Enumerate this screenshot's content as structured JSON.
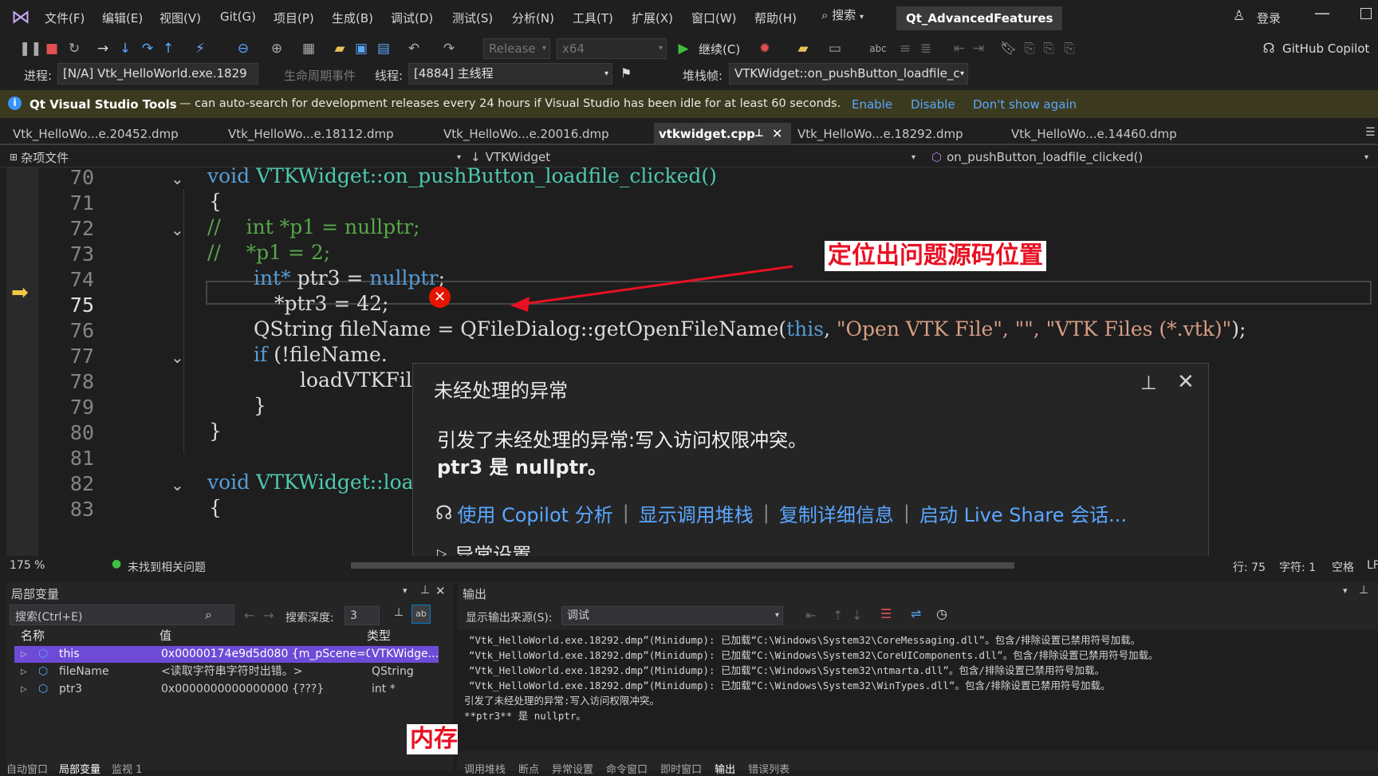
{
  "menu": {
    "items": [
      "文件(F)",
      "编辑(E)",
      "视图(V)",
      "Git(G)",
      "项目(P)",
      "生成(B)",
      "调试(D)",
      "测试(S)",
      "分析(N)",
      "工具(T)",
      "扩展(X)",
      "窗口(W)",
      "帮助(H)"
    ],
    "search": "搜索",
    "solution": "Qt_AdvancedFeatures",
    "login": "登录",
    "copilot": "GitHub Copilot"
  },
  "toolbar": {
    "config": "Release",
    "platform": "x64",
    "continue": "继续(C)"
  },
  "debugbar": {
    "process_label": "进程:",
    "process_value": "[N/A] Vtk_HelloWorld.exe.1829",
    "lifecycle": "生命周期事件",
    "thread_label": "线程:",
    "thread_value": "[4884] 主线程",
    "stack_label": "堆栈帧:",
    "stack_value": "VTKWidget::on_pushButton_loadfile_c"
  },
  "infobar": {
    "title": "Qt Visual Studio Tools",
    "message": "— can auto-search for development releases every 24 hours if Visual Studio has been idle for at least 60 seconds.",
    "enable": "Enable",
    "disable": "Disable",
    "dont_show": "Don't show again"
  },
  "tabs": [
    {
      "label": "Vtk_HelloWo...e.20452.dmp"
    },
    {
      "label": "Vtk_HelloWo...e.18112.dmp"
    },
    {
      "label": "Vtk_HelloWo...e.20016.dmp"
    },
    {
      "label": "vtkwidget.cpp"
    },
    {
      "label": "Vtk_HelloWo...e.18292.dmp"
    },
    {
      "label": "Vtk_HelloWo...e.14460.dmp"
    }
  ],
  "navbar": {
    "scope": "杂项文件",
    "class": "VTKWidget",
    "method": "on_pushButton_loadfile_clicked()"
  },
  "code": {
    "line_numbers": [
      "70",
      "71",
      "72",
      "73",
      "74",
      "75",
      "76",
      "77",
      "78",
      "79",
      "80",
      "81",
      "82",
      "83"
    ],
    "l70_kw": "void",
    "l70_rest": "VTKWidget::on_pushButton_loadfile_clicked()",
    "l71": "{",
    "l72": "//    int *p1 = nullptr;",
    "l73": "//    *p1 = 2;",
    "l74_kw": "int*",
    "l74_rest": " ptr3 = ",
    "l74_null": "nullptr",
    "l74_end": ";",
    "l75": "*ptr3 = 42;",
    "l76_a": "QString fileName = QFileDialog::getOpenFileName(",
    "l76_this": "this",
    "l76_b": ", ",
    "l76_str": "\"Open VTK File\", \"\", \"VTK Files (*.vtk)\"",
    "l76_end": ");",
    "l77_kw": "if",
    "l77_rest": " (!fileName.",
    "l78": "loadVTKFil",
    "l79": "}",
    "l80": "}",
    "l82_kw": "void",
    "l82_rest": "VTKWidget::loa",
    "l83": "{"
  },
  "popup": {
    "title": "未经处理的异常",
    "message1": "引发了未经处理的异常:写入访问权限冲突。",
    "message2": "ptr3 是 nullptr。",
    "copilot": "使用 Copilot 分析",
    "callstack": "显示调用堆栈",
    "copy": "复制详细信息",
    "liveshare": "启动 Live Share 会话...",
    "settings": "异常设置"
  },
  "annotations": {
    "source": "定位出问题源码位置",
    "memory": "内存变量值"
  },
  "status": {
    "zoom": "175 %",
    "issues": "未找到相关问题",
    "line": "行: 75",
    "char": "字符: 1",
    "space": "空格",
    "eol": "LF"
  },
  "locals": {
    "title": "局部变量",
    "search_placeholder": "搜索(Ctrl+E)",
    "depth_label": "搜索深度:",
    "depth": "3",
    "col_name": "名称",
    "col_value": "值",
    "col_type": "类型",
    "rows": [
      {
        "name": "this",
        "value": "0x00000174e9d5d080 {m_pScene=0x...",
        "type": "VTKWidge..."
      },
      {
        "name": "fileName",
        "value": "<读取字符串字符时出错。>",
        "type": "QString"
      },
      {
        "name": "ptr3",
        "value": "0x0000000000000000 {???}",
        "type": "int *"
      }
    ],
    "bottom_tabs": [
      "自动窗口",
      "局部变量",
      "监视 1"
    ]
  },
  "output": {
    "title": "输出",
    "source_label": "显示输出来源(S):",
    "source": "调试",
    "lines": [
      "“Vtk_HelloWorld.exe.18292.dmp”(Minidump): 已加载“C:\\Windows\\System32\\CoreMessaging.dll”。包含/排除设置已禁用符号加载。",
      "“Vtk_HelloWorld.exe.18292.dmp”(Minidump): 已加载“C:\\Windows\\System32\\CoreUIComponents.dll”。包含/排除设置已禁用符号加载。",
      "“Vtk_HelloWorld.exe.18292.dmp”(Minidump): 已加载“C:\\Windows\\System32\\ntmarta.dll”。包含/排除设置已禁用符号加载。",
      "“Vtk_HelloWorld.exe.18292.dmp”(Minidump): 已加载“C:\\Windows\\System32\\WinTypes.dll”。包含/排除设置已禁用符号加载。",
      "引发了未经处理的异常:写入访问权限冲突。",
      "**ptr3** 是 nullptr。"
    ],
    "bottom_tabs": [
      "调用堆栈",
      "断点",
      "异常设置",
      "命令窗口",
      "即时窗口",
      "输出",
      "错误列表"
    ]
  }
}
